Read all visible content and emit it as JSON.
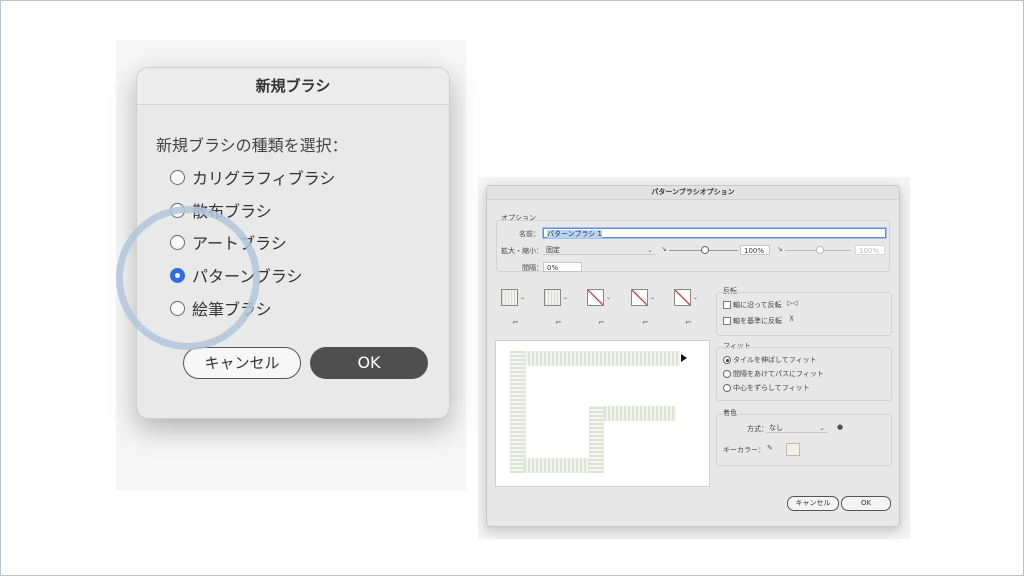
{
  "new_brush_dialog": {
    "title": "新規ブラシ",
    "prompt": "新規ブラシの種類を選択：",
    "options": [
      {
        "label": "カリグラフィブラシ",
        "selected": false
      },
      {
        "label": "散布ブラシ",
        "selected": false
      },
      {
        "label": "アートブラシ",
        "selected": false
      },
      {
        "label": "パターンブラシ",
        "selected": true
      },
      {
        "label": "絵筆ブラシ",
        "selected": false
      }
    ],
    "cancel_label": "キャンセル",
    "ok_label": "OK"
  },
  "pattern_brush_dialog": {
    "title": "パターンブラシオプション",
    "options_group_label": "オプション",
    "name_label": "名前：",
    "name_value": "パターンブラシ 1",
    "scale_label": "拡大・縮小：",
    "scale_mode": "固定",
    "scale_value": "100%",
    "scale_value_disabled": "100%",
    "spacing_label": "間隔：",
    "spacing_value": "0%",
    "flip_group_label": "反転",
    "flip_along": "軸に沿って反転",
    "flip_across": "軸を基準に反転",
    "fit_group_label": "フィット",
    "fit_options": [
      {
        "label": "タイルを伸ばしてフィット",
        "selected": true
      },
      {
        "label": "間隔をあけてパスにフィット",
        "selected": false
      },
      {
        "label": "中心をずらしてフィット",
        "selected": false
      }
    ],
    "colorization_group_label": "着色",
    "method_label": "方式：",
    "method_value": "なし",
    "key_color_label": "キーカラー：",
    "key_color": "#f3f0e6",
    "cancel_label": "キャンセル",
    "ok_label": "OK"
  },
  "colors": {
    "radio_selected": "#2f6fe0",
    "ok_button_bg": "#4f4f4f",
    "magnifier_ring": "#b2c6da"
  }
}
